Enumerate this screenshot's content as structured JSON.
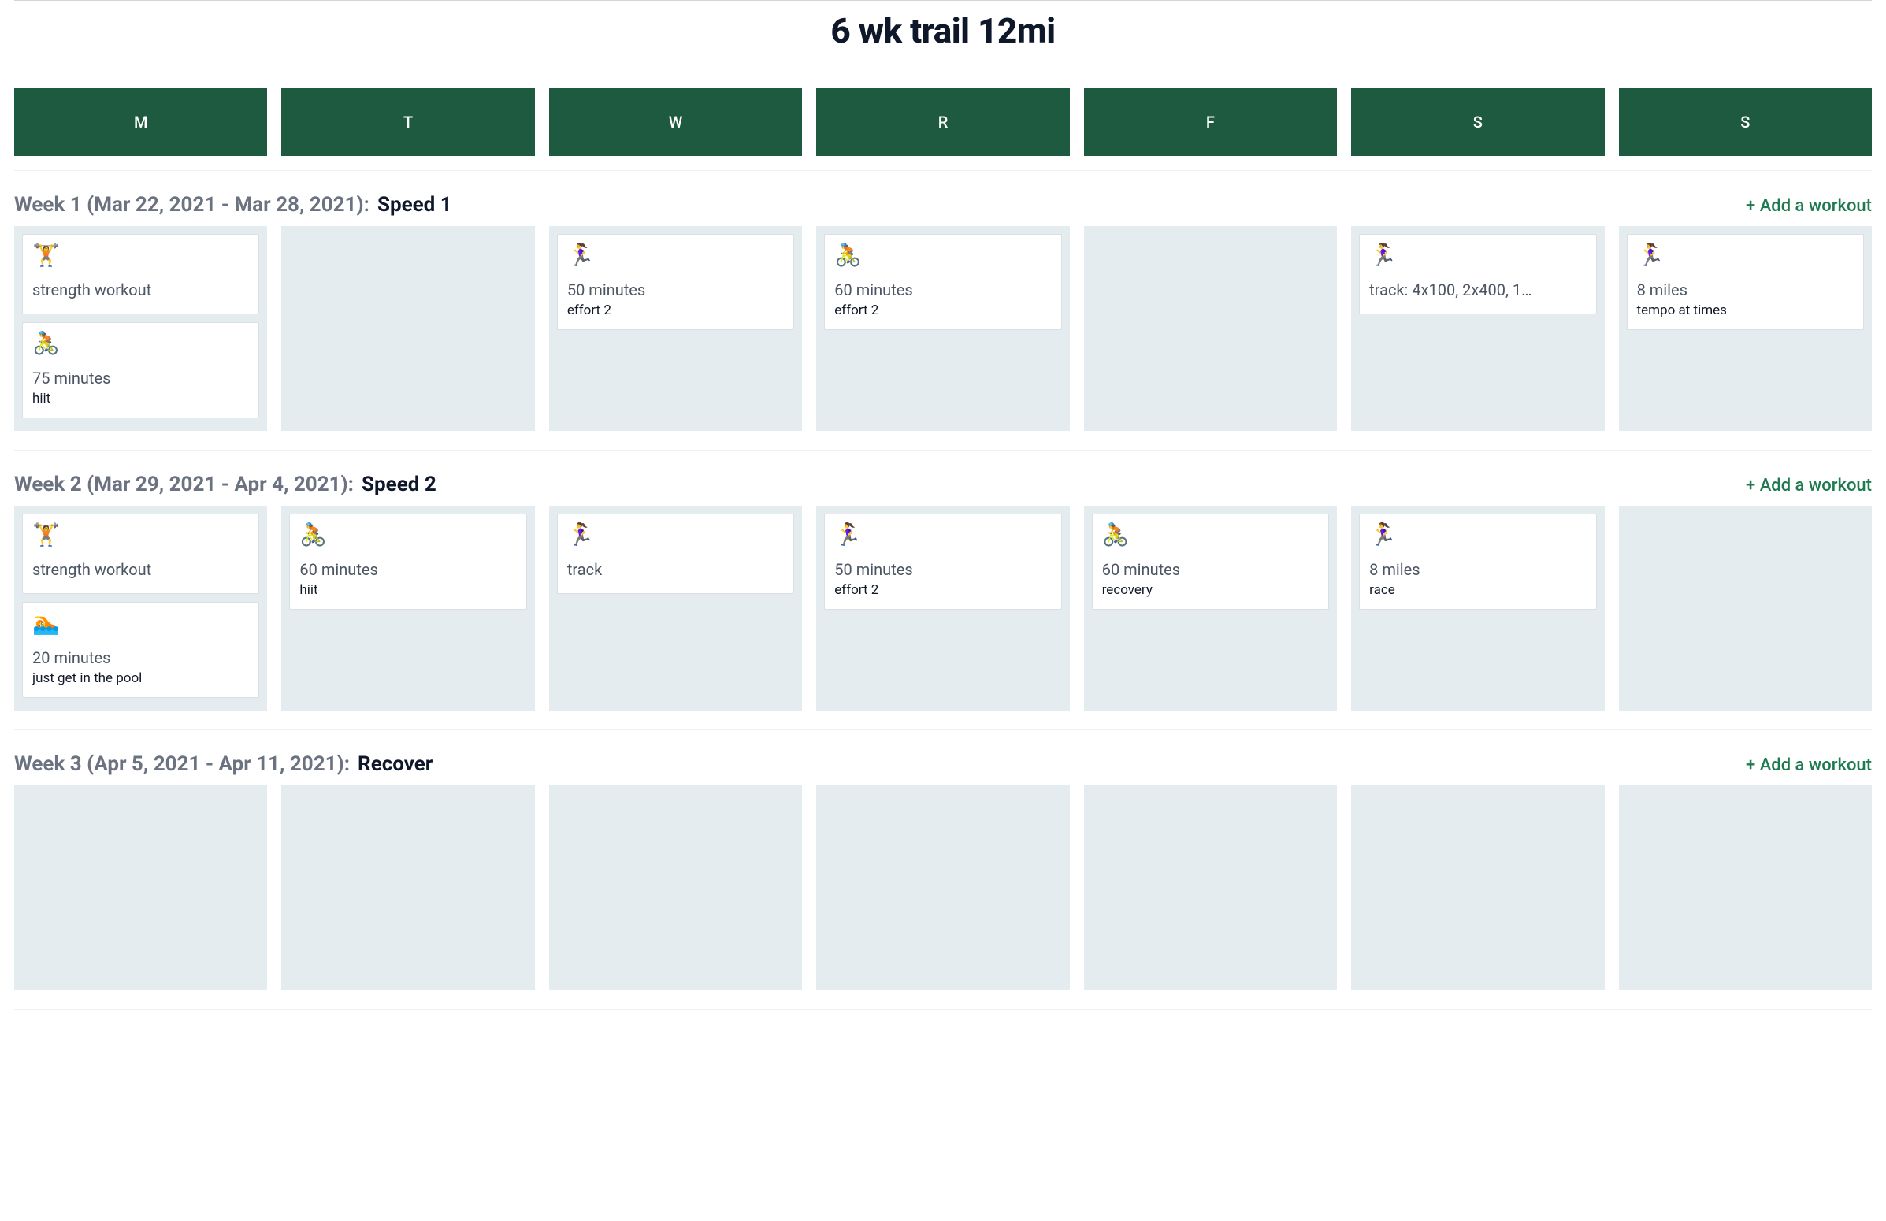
{
  "title": "6 wk trail 12mi",
  "day_headers": [
    "M",
    "T",
    "W",
    "R",
    "F",
    "S",
    "S"
  ],
  "add_workout_label": "+ Add a workout",
  "icons": {
    "strength": "🏋️",
    "cycle": "🚴",
    "run": "🏃‍♀️",
    "swim": "🏊"
  },
  "weeks": [
    {
      "label": "Week 1 (Mar 22, 2021 - Mar 28, 2021):",
      "name": "Speed 1",
      "days": [
        [
          {
            "icon": "strength",
            "title": "strength workout",
            "sub": ""
          },
          {
            "icon": "cycle",
            "title": "75 minutes",
            "sub": "hiit"
          }
        ],
        [],
        [
          {
            "icon": "run",
            "title": "50 minutes",
            "sub": "effort 2"
          }
        ],
        [
          {
            "icon": "cycle",
            "title": "60 minutes",
            "sub": "effort 2"
          }
        ],
        [],
        [
          {
            "icon": "run",
            "title": "track: 4x100, 2x400, 1…",
            "sub": ""
          }
        ],
        [
          {
            "icon": "run",
            "title": "8 miles",
            "sub": "tempo at times"
          }
        ]
      ]
    },
    {
      "label": "Week 2 (Mar 29, 2021 - Apr 4, 2021):",
      "name": "Speed 2",
      "days": [
        [
          {
            "icon": "strength",
            "title": "strength workout",
            "sub": ""
          },
          {
            "icon": "swim",
            "title": "20 minutes",
            "sub": "just get in the pool"
          }
        ],
        [
          {
            "icon": "cycle",
            "title": "60 minutes",
            "sub": "hiit"
          }
        ],
        [
          {
            "icon": "run",
            "title": "track",
            "sub": ""
          }
        ],
        [
          {
            "icon": "run",
            "title": "50 minutes",
            "sub": "effort 2"
          }
        ],
        [
          {
            "icon": "cycle",
            "title": "60 minutes",
            "sub": "recovery"
          }
        ],
        [
          {
            "icon": "run",
            "title": "8 miles",
            "sub": "race"
          }
        ],
        []
      ]
    },
    {
      "label": "Week 3 (Apr 5, 2021 - Apr 11, 2021):",
      "name": "Recover",
      "days": [
        [],
        [],
        [],
        [],
        [],
        [],
        []
      ]
    }
  ]
}
